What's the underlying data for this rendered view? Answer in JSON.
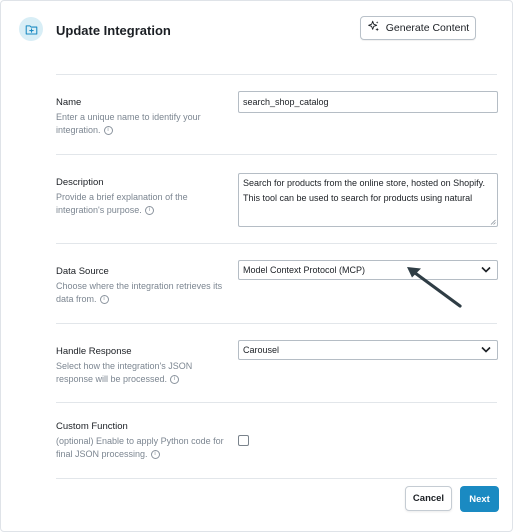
{
  "dialog": {
    "title": "Update Integration",
    "generate_label": "Generate Content",
    "info_glyph": "i"
  },
  "fields": {
    "name": {
      "label": "Name",
      "help": "Enter a unique name to identify your integration.",
      "value": "search_shop_catalog"
    },
    "description": {
      "label": "Description",
      "help": "Provide a brief explanation of the integration's purpose.",
      "value": "Search for products from the online store, hosted on Shopify.\nThis tool can be used to search for products using natural"
    },
    "data_source": {
      "label": "Data Source",
      "help": "Choose where the integration retrieves its data from.",
      "value": "Model Context Protocol (MCP)"
    },
    "handle_response": {
      "label": "Handle Response",
      "help": "Select how the integration's JSON response will be processed.",
      "value": "Carousel"
    },
    "custom_function": {
      "label": "Custom Function",
      "help": "(optional) Enable to apply Python code for final JSON processing.",
      "checked": false
    }
  },
  "footer": {
    "cancel_label": "Cancel",
    "next_label": "Next"
  },
  "colors": {
    "accent": "#1a8ac2",
    "icon_bg": "#d8eef6",
    "annotation_arrow": "#2f3d45"
  },
  "icons": {
    "header": "folder-plus-icon",
    "generate": "sparkles-icon",
    "info": "info-icon",
    "select": "chevron-down-icon"
  }
}
